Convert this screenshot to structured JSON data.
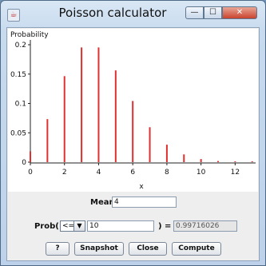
{
  "window": {
    "title": "Poisson calculator",
    "app_icon": "java-icon",
    "minimize_glyph": "—",
    "maximize_glyph": "☐",
    "close_glyph": "✕"
  },
  "chart_data": {
    "type": "bar",
    "ylabel": "Probability",
    "xlabel": "x",
    "x": [
      0,
      1,
      2,
      3,
      4,
      5,
      6,
      7,
      8,
      9,
      10,
      11,
      12,
      13
    ],
    "values": [
      0.0183,
      0.0733,
      0.1465,
      0.1954,
      0.1954,
      0.1563,
      0.1042,
      0.0595,
      0.0298,
      0.0132,
      0.0053,
      0.0019,
      0.0006,
      0.0002
    ],
    "x_ticks": [
      "0",
      "2",
      "4",
      "6",
      "8",
      "10",
      "12"
    ],
    "y_ticks": [
      "0",
      "0.05",
      "0.1",
      "0.15",
      "0.2"
    ],
    "xlim": [
      0,
      13.2
    ],
    "ylim": [
      0,
      0.2
    ],
    "bar_color": "#e03030",
    "grid": false
  },
  "controls": {
    "mean_label": "Mean:",
    "mean_value": "4",
    "prob_label": "Prob( X",
    "operator_value": "<=",
    "combo_arrow": "▼",
    "bound_value": "10",
    "equals_label": ") =",
    "result_value": "0.99716026"
  },
  "buttons": {
    "help_label": "?",
    "snapshot_label": "Snapshot",
    "close_label": "Close",
    "compute_label": "Compute"
  }
}
